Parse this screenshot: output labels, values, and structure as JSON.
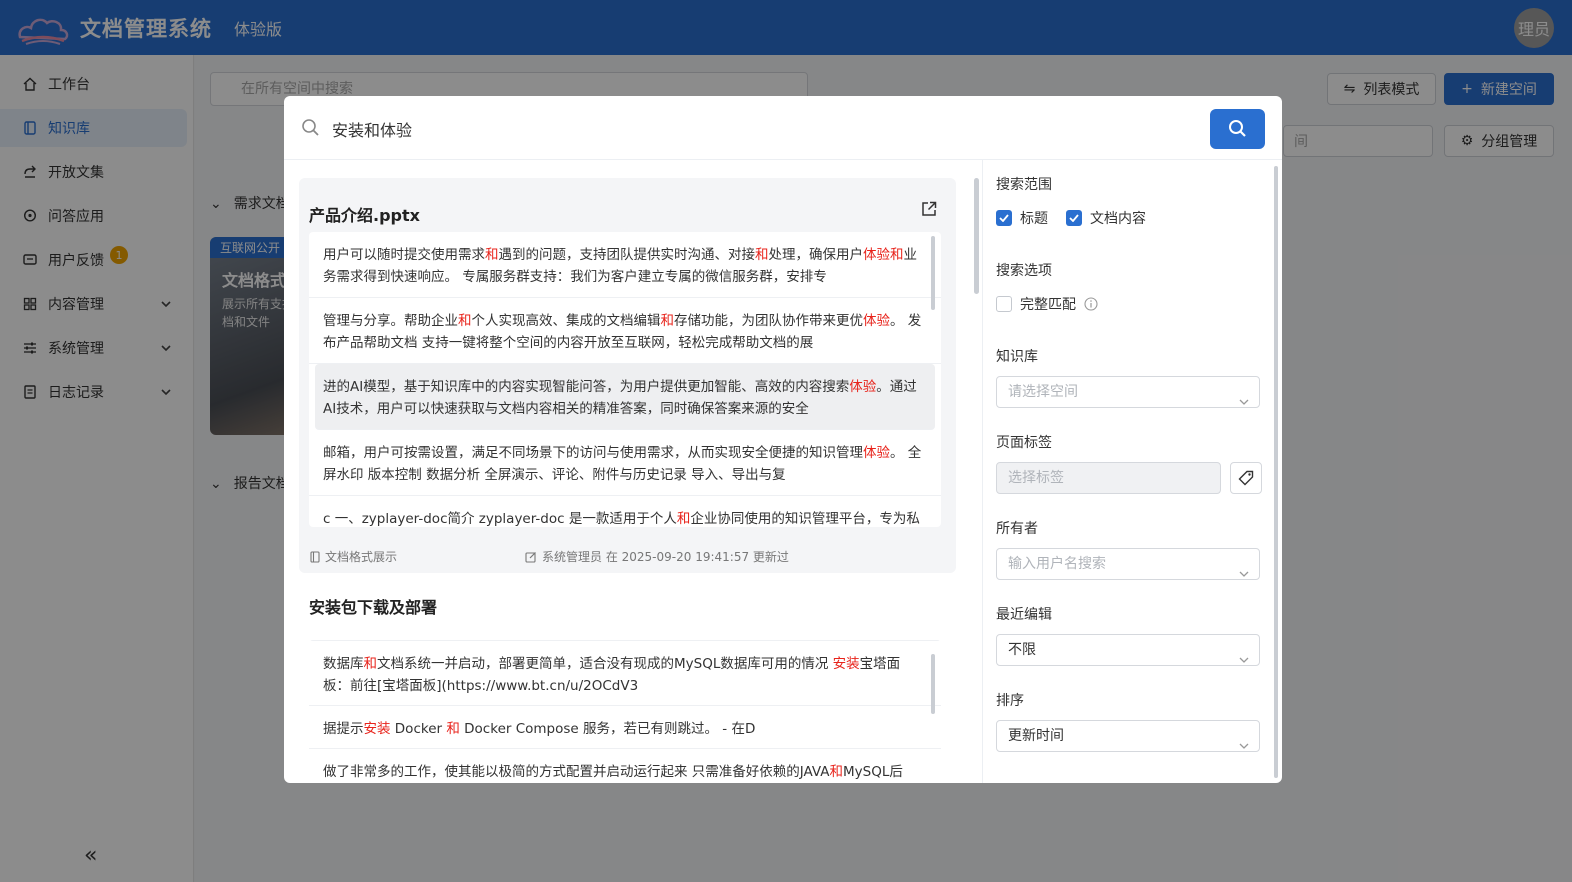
{
  "header": {
    "app_title": "文档管理系统",
    "edition": "体验版",
    "user_avatar_text": "理员",
    "brand_color": "#2a6fd0"
  },
  "sidebar": {
    "items": [
      {
        "label": "工作台",
        "icon": "home-icon"
      },
      {
        "label": "知识库",
        "icon": "book-icon",
        "active": true
      },
      {
        "label": "开放文集",
        "icon": "share-icon"
      },
      {
        "label": "问答应用",
        "icon": "chat-icon"
      },
      {
        "label": "用户反馈",
        "icon": "feedback-icon",
        "badge": "1"
      },
      {
        "label": "内容管理",
        "icon": "grid-icon"
      },
      {
        "label": "系统管理",
        "icon": "sliders-icon"
      },
      {
        "label": "日志记录",
        "icon": "log-icon"
      }
    ],
    "collapse_glyph": "«"
  },
  "background": {
    "search_placeholder": "在所有空间中搜索",
    "list_mode_label": "列表模式",
    "new_space_label": "新建空间",
    "group_manage_label": "分组管理",
    "filter_placeholder_fragment": "间",
    "section_1": "需求文档",
    "section_2": "报告文档",
    "card_tag": "互联网公开",
    "card_title": "文档格式",
    "card_desc": "展示所有支持的文档和文件"
  },
  "modal": {
    "search_value": "安装和体验",
    "results": [
      {
        "title": "产品介绍.pptx",
        "snippets": [
          [
            {
              "t": "用户可以随时提交使用需求"
            },
            {
              "t": "和",
              "k": true
            },
            {
              "t": "遇到的问题，支持团队提供实时沟通、对接"
            },
            {
              "t": "和",
              "k": true
            },
            {
              "t": "处理，确保用户"
            },
            {
              "t": "体验",
              "k": true
            },
            {
              "t": "和",
              "k": true
            },
            {
              "t": "业务需求得到快速响应。 专属服务群支持：我们为客户建立专属的微信服务群，安排专"
            }
          ],
          [
            {
              "t": "管理与分享。帮助企业"
            },
            {
              "t": "和",
              "k": true
            },
            {
              "t": "个人实现高效、集成的文档编辑"
            },
            {
              "t": "和",
              "k": true
            },
            {
              "t": "存储功能，为团队协作带来更优"
            },
            {
              "t": "体验",
              "k": true
            },
            {
              "t": "。 发布产品帮助文档 支持一键将整个空间的内容开放至互联网，轻松完成帮助文档的展"
            }
          ],
          [
            {
              "t": "进的AI模型，基于知识库中的内容实现智能问答，为用户提供更加智能、高效的内容搜索"
            },
            {
              "t": "体验",
              "k": true
            },
            {
              "t": "。通过AI技术，用户可以快速获取与文档内容相关的精准答案，同时确保答案来源的安全"
            }
          ],
          [
            {
              "t": "邮箱，用户可按需设置，满足不同场景下的访问与使用需求，从而实现安全便捷的知识管理"
            },
            {
              "t": "体验",
              "k": true
            },
            {
              "t": "。 全屏水印 版本控制 数据分析 全屏演示、评论、附件与历史记录 导入、导出与复"
            }
          ],
          [
            {
              "t": "c 一、zyplayer-doc简介 zyplayer-doc 是一款适用于个人"
            },
            {
              "t": "和",
              "k": true
            },
            {
              "t": "企业协同使用的知识管理平台，专为私"
            }
          ]
        ],
        "space": "文档格式展示",
        "editor_info": "系统管理员 在 2025-09-20 19:41:57 更新过"
      },
      {
        "title_parts": [
          {
            "t": "安装",
            "k": true
          },
          {
            "t": "包下载及部署"
          }
        ],
        "snippets": [
          [
            {
              "t": "数据库"
            },
            {
              "t": "和",
              "k": true
            },
            {
              "t": "文档系统一并启动，部署更简单，适合没有现成的MySQL数据库可用的情况 "
            },
            {
              "t": "安装",
              "k": true
            },
            {
              "t": "宝塔面板：前往[宝塔面板](https://www.bt.cn/u/2OCdV3"
            }
          ],
          [
            {
              "t": "据提示"
            },
            {
              "t": "安装",
              "k": true
            },
            {
              "t": " Docker "
            },
            {
              "t": "和",
              "k": true
            },
            {
              "t": " Docker Compose 服务，若已有则跳过。 - 在D"
            }
          ],
          [
            {
              "t": "做了非常多的工作，使其能以极简的方式配置并启动运行起来 只需准备好依赖的JAVA"
            },
            {
              "t": "和",
              "k": true
            },
            {
              "t": "MySQL后"
            }
          ]
        ]
      }
    ],
    "filters": {
      "scope_label": "搜索范围",
      "scope_title": "标题",
      "scope_content": "文档内容",
      "options_label": "搜索选项",
      "exact_match": "完整匹配",
      "kb_label": "知识库",
      "kb_placeholder": "请选择空间",
      "tag_label": "页面标签",
      "tag_placeholder": "选择标签",
      "owner_label": "所有者",
      "owner_placeholder": "输入用户名搜索",
      "recent_label": "最近编辑",
      "recent_value": "不限",
      "sort_label": "排序",
      "sort_value": "更新时间"
    }
  }
}
